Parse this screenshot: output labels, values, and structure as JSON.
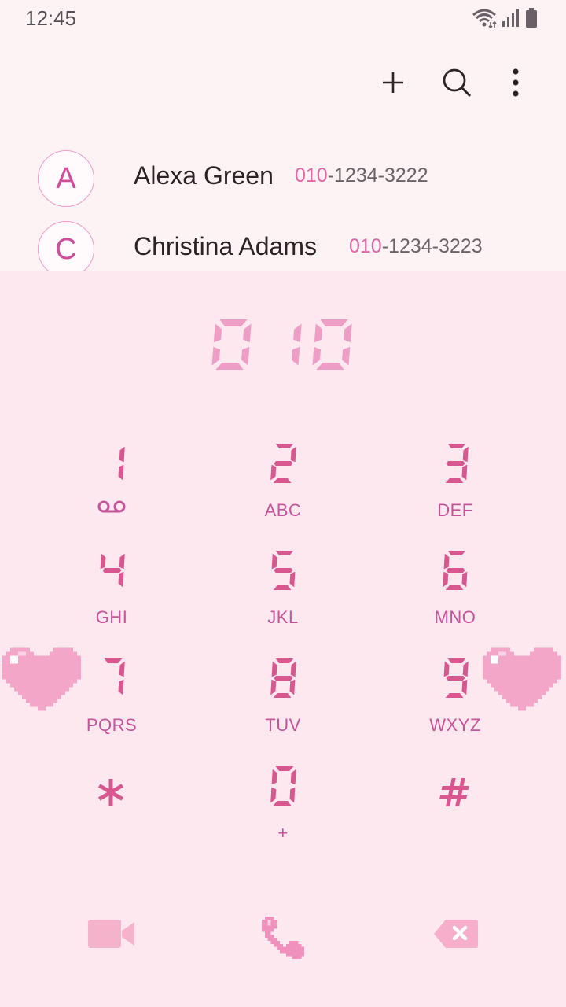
{
  "status_bar": {
    "time": "12:45"
  },
  "toolbar": {
    "add_icon": "plus-icon",
    "search_icon": "search-icon",
    "more_icon": "more-vertical-icon"
  },
  "contacts": [
    {
      "initial": "A",
      "name": "Alexa Green",
      "number_match": "010",
      "number_rest": "-1234-3222"
    },
    {
      "initial": "C",
      "name": "Christina Adams",
      "number_match": "010",
      "number_rest": "-1234-3223"
    }
  ],
  "dialer": {
    "entered_number": "010",
    "keys": [
      {
        "digit": "1",
        "letters": ""
      },
      {
        "digit": "2",
        "letters": "ABC"
      },
      {
        "digit": "3",
        "letters": "DEF"
      },
      {
        "digit": "4",
        "letters": "GHI"
      },
      {
        "digit": "5",
        "letters": "JKL"
      },
      {
        "digit": "6",
        "letters": "MNO"
      },
      {
        "digit": "7",
        "letters": "PQRS"
      },
      {
        "digit": "8",
        "letters": "TUV"
      },
      {
        "digit": "9",
        "letters": "WXYZ"
      },
      {
        "digit": "*",
        "letters": ""
      },
      {
        "digit": "0",
        "letters": "+"
      },
      {
        "digit": "#",
        "letters": ""
      }
    ],
    "voicemail_icon": "voicemail-icon"
  },
  "actions": {
    "video_call_icon": "video-camera-icon",
    "call_icon": "phone-icon",
    "backspace_icon": "backspace-icon"
  },
  "colors": {
    "background": "#fdf2f4",
    "dial_panel": "#fde8ef",
    "accent": "#d8578f",
    "display_digits": "#ee9ec4",
    "hearts": "#f4a6c8"
  }
}
